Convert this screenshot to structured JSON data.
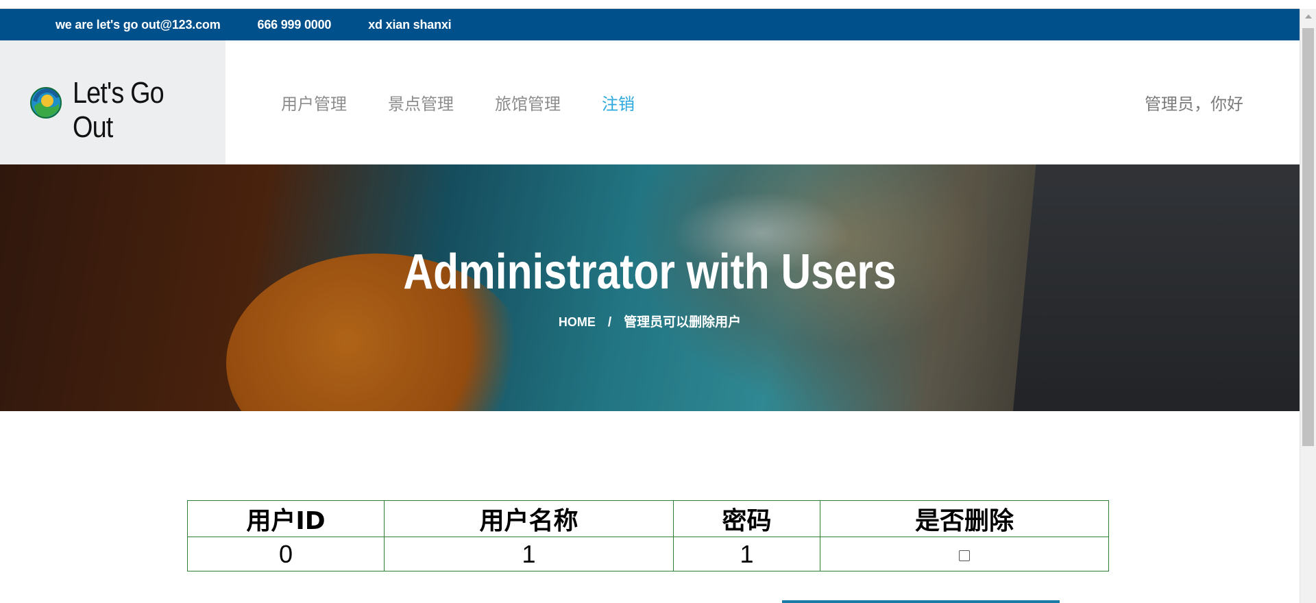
{
  "topbar": {
    "email": "we are let's go out@123.com",
    "phone": "666 999 0000",
    "address": "xd xian shanxi"
  },
  "brand": {
    "name": "Let's Go Out",
    "logo_icon": "globe-logo-icon"
  },
  "nav": {
    "items": [
      {
        "label": "用户管理",
        "active": false
      },
      {
        "label": "景点管理",
        "active": false
      },
      {
        "label": "旅馆管理",
        "active": false
      },
      {
        "label": "注销",
        "active": true
      }
    ],
    "greeting": "管理员，你好"
  },
  "hero": {
    "title": "Administrator with Users",
    "breadcrumb": {
      "home": "HOME",
      "separator": "/",
      "current": "管理员可以删除用户"
    }
  },
  "users_table": {
    "headers": [
      "用户ID",
      "用户名称",
      "密码",
      "是否删除"
    ],
    "rows": [
      {
        "id": "0",
        "name": "1",
        "password": "1",
        "delete_checked": false
      }
    ]
  },
  "colors": {
    "topbar_bg": "#00508c",
    "nav_active": "#2aa8de",
    "table_border": "#2e7d32"
  }
}
